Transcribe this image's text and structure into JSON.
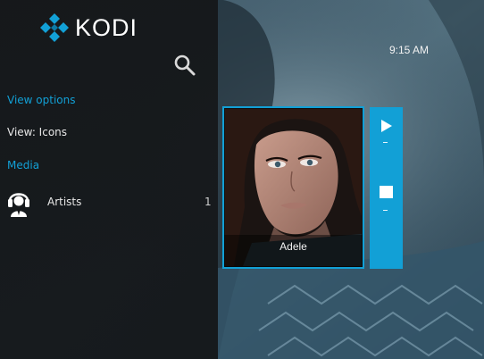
{
  "app": {
    "name": "KODI"
  },
  "clock": "9:15 AM",
  "sidebar": {
    "view_options_header": "View options",
    "view_item": "View: Icons",
    "media_header": "Media",
    "artists": {
      "label": "Artists",
      "count": "1"
    }
  },
  "card": {
    "title": "Adele"
  },
  "icons": {
    "logo": "kodi-logo-icon",
    "search": "search-icon",
    "artists": "artist-headphones-icon",
    "play": "play-icon",
    "stop": "stop-icon"
  },
  "colors": {
    "accent": "#12a0d6",
    "sidebar_bg": "#141618",
    "text": "#e8e8e8"
  }
}
